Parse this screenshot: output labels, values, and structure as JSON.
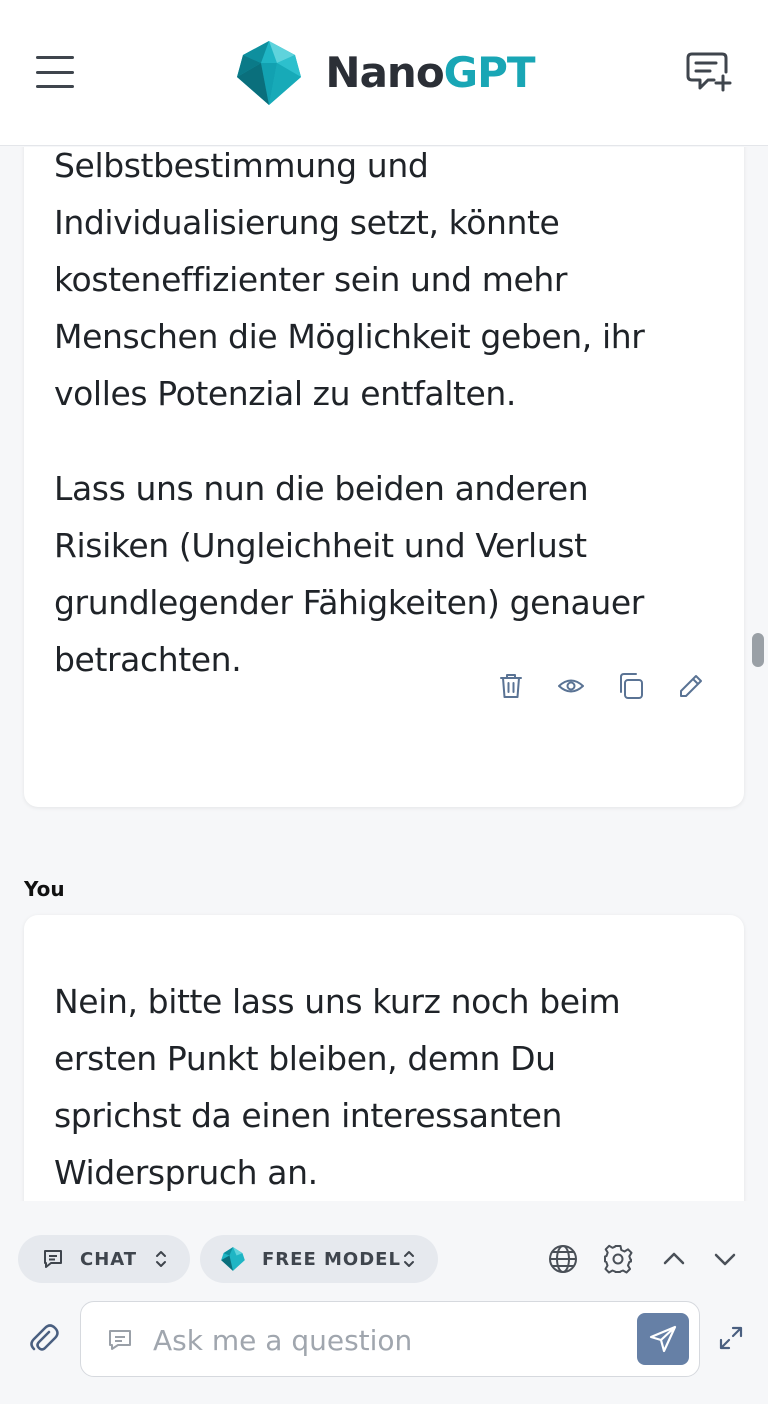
{
  "header": {
    "logo_nano": "Nano",
    "logo_gpt": "GPT",
    "brand_color": "#19a6b5"
  },
  "messages": {
    "assistant": {
      "paragraph_1_lines": [
        "Selbstbestimmung und",
        "Individualisierung setzt, könnte",
        "kosteneffizienter sein und mehr",
        "Menschen die Möglichkeit geben, ihr",
        "volles Potenzial zu entfalten."
      ],
      "paragraph_2_lines": [
        "Lass uns nun die beiden anderen",
        "Risiken (Ungleichheit und Verlust",
        "grundlegender Fähigkeiten) genauer",
        "betrachten."
      ],
      "actions": [
        "trash-icon",
        "eye-icon",
        "copy-icon",
        "edit-icon"
      ]
    },
    "user": {
      "label": "You",
      "lines": [
        "Nein, bitte lass uns kurz noch beim",
        "ersten Punkt bleiben, demn Du",
        "sprichst da einen interessanten",
        "Widerspruch an."
      ]
    }
  },
  "composer": {
    "mode_label": "CHAT",
    "model_label": "FREE MODEL",
    "placeholder": "Ask me a question",
    "value": "",
    "send_color": "#6680a6"
  }
}
